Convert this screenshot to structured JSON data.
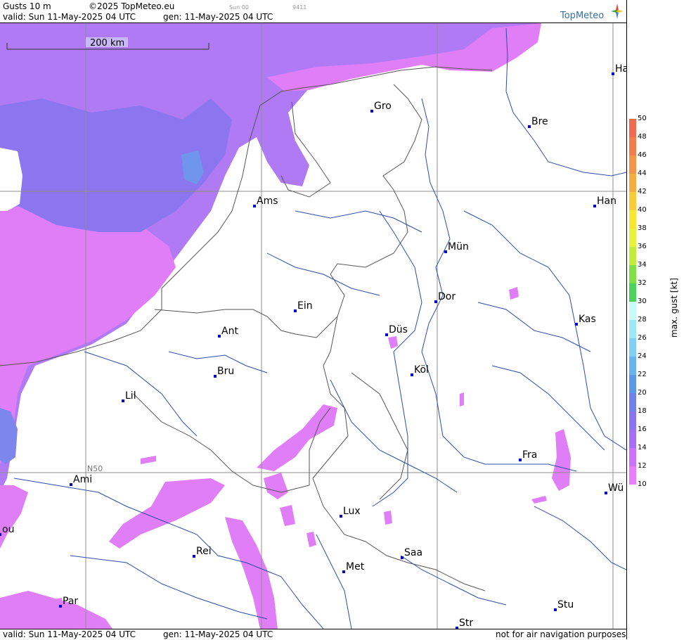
{
  "header": {
    "product": "Gusts 10 m",
    "copyright": "©2025 TopMeteo.eu",
    "run": "Sun 00",
    "code": "9411",
    "valid": "valid:  Sun  11-May-2025  04 UTC",
    "gen": "gen: 11-May-2025 04 UTC",
    "logo": "TopMeteo"
  },
  "footer": {
    "valid": "valid:  Sun  11-May-2025  04 UTC",
    "gen": "gen: 11-May-2025 04 UTC",
    "disclaimer": "not for air navigation purposes"
  },
  "map": {
    "scale_label": "200 km",
    "latitude_label": "N50",
    "cities": [
      "Ha",
      "Gro",
      "Bre",
      "Ams",
      "Han",
      "Mün",
      "Dor",
      "Ein",
      "Düs",
      "Kas",
      "Ant",
      "Köl",
      "Bru",
      "Lil",
      "Fra",
      "Ami",
      "Wü",
      "Lux",
      "ou",
      "Rei",
      "Saa",
      "Met",
      "Par",
      "Stu",
      "Str"
    ]
  },
  "legend": {
    "title": "max. gust [kt]",
    "ticks": [
      "50",
      "48",
      "46",
      "44",
      "42",
      "40",
      "38",
      "36",
      "34",
      "32",
      "30",
      "28",
      "26",
      "24",
      "22",
      "20",
      "18",
      "16",
      "14",
      "12",
      "10"
    ],
    "colors": [
      "#f06a50",
      "#f27c4c",
      "#f49448",
      "#f6ad40",
      "#f8cc38",
      "#f7e734",
      "#e9f23a",
      "#c2ec3c",
      "#7fe046",
      "#4cd25a",
      "#c8fafa",
      "#9ee8f6",
      "#7fd0f4",
      "#68b4ee",
      "#5a98e8",
      "#6f82ec",
      "#8a73f0",
      "#a56ef6",
      "#cc72fa",
      "#e87dfa"
    ]
  }
}
